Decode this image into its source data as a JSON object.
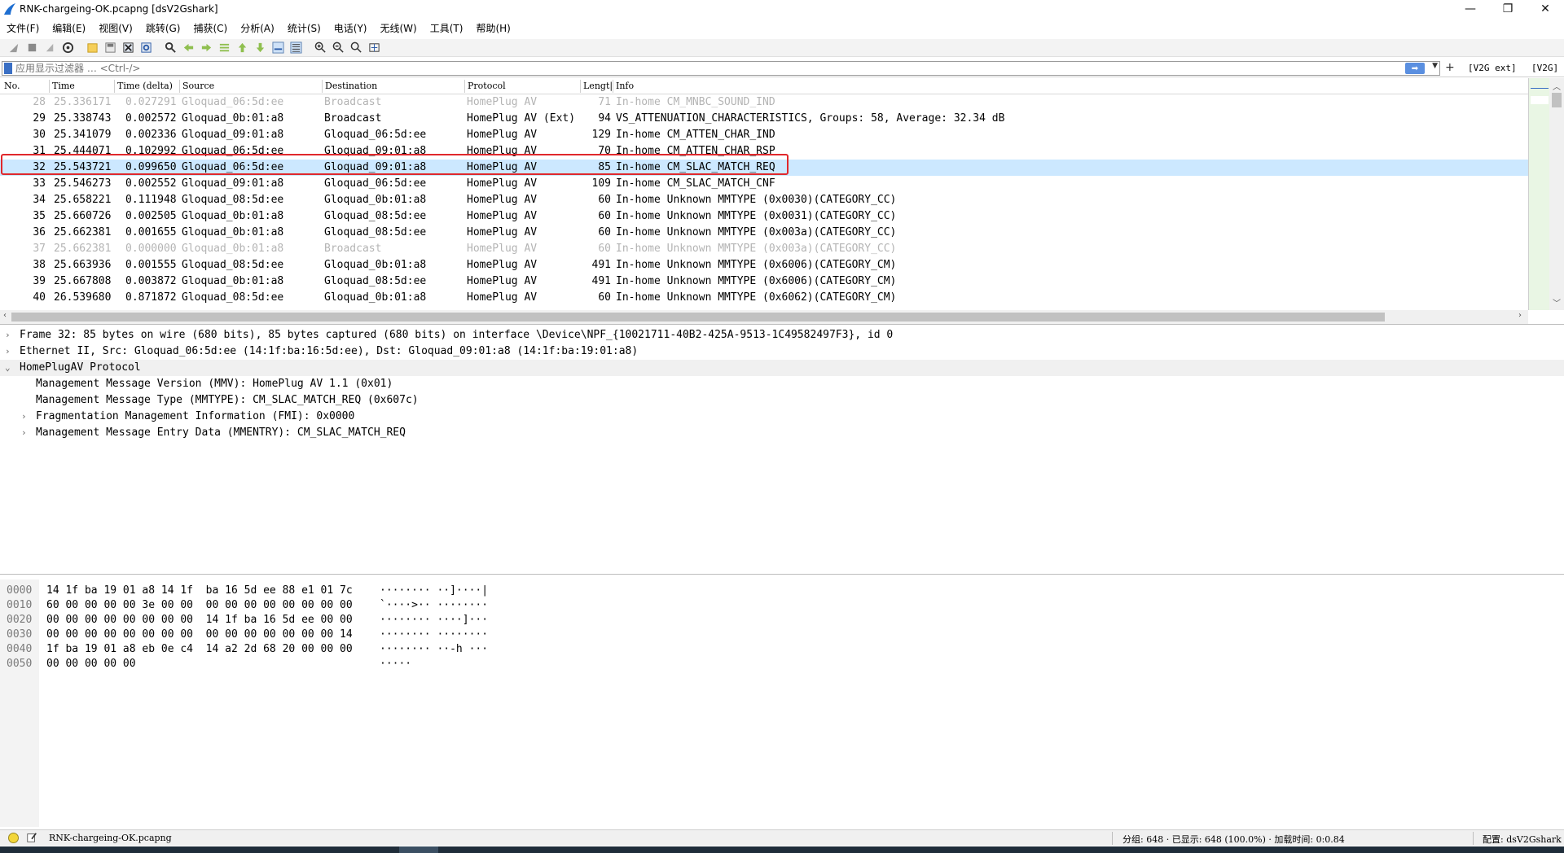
{
  "window": {
    "title": "RNK-chargeing-OK.pcapng [dsV2Gshark]",
    "minimize": "—",
    "restore": "❐",
    "close": "✕"
  },
  "menu": [
    "文件(F)",
    "编辑(E)",
    "视图(V)",
    "跳转(G)",
    "捕获(C)",
    "分析(A)",
    "统计(S)",
    "电话(Y)",
    "无线(W)",
    "工具(T)",
    "帮助(H)"
  ],
  "filter": {
    "placeholder": "应用显示过滤器 … <Ctrl-/>",
    "value": "",
    "apply_icon": "arrow-right-icon",
    "plus_label": "+",
    "button1": "[V2G ext]",
    "button2": "[V2G]"
  },
  "packet_list": {
    "columns": [
      "No.",
      "Time",
      "Time (delta)",
      "Source",
      "Destination",
      "Protocol",
      "Lengt|",
      "Info"
    ],
    "rows": [
      {
        "no": "28",
        "time": "25.336171",
        "delta": "0.027291",
        "src": "Gloquad_06:5d:ee",
        "dst": "Broadcast",
        "proto": "HomePlug AV",
        "len": "71",
        "info": "In-home CM_MNBC_SOUND_IND",
        "dim": true
      },
      {
        "no": "29",
        "time": "25.338743",
        "delta": "0.002572",
        "src": "Gloquad_0b:01:a8",
        "dst": "Broadcast",
        "proto": "HomePlug AV (Ext)",
        "len": "94",
        "info": "VS_ATTENUATION_CHARACTERISTICS, Groups: 58, Average: 32.34 dB"
      },
      {
        "no": "30",
        "time": "25.341079",
        "delta": "0.002336",
        "src": "Gloquad_09:01:a8",
        "dst": "Gloquad_06:5d:ee",
        "proto": "HomePlug AV",
        "len": "129",
        "info": "In-home CM_ATTEN_CHAR_IND"
      },
      {
        "no": "31",
        "time": "25.444071",
        "delta": "0.102992",
        "src": "Gloquad_06:5d:ee",
        "dst": "Gloquad_09:01:a8",
        "proto": "HomePlug AV",
        "len": "70",
        "info": "In-home CM_ATTEN_CHAR_RSP"
      },
      {
        "no": "32",
        "time": "25.543721",
        "delta": "0.099650",
        "src": "Gloquad_06:5d:ee",
        "dst": "Gloquad_09:01:a8",
        "proto": "HomePlug AV",
        "len": "85",
        "info": "In-home CM_SLAC_MATCH_REQ",
        "selected": true
      },
      {
        "no": "33",
        "time": "25.546273",
        "delta": "0.002552",
        "src": "Gloquad_09:01:a8",
        "dst": "Gloquad_06:5d:ee",
        "proto": "HomePlug AV",
        "len": "109",
        "info": "In-home CM_SLAC_MATCH_CNF"
      },
      {
        "no": "34",
        "time": "25.658221",
        "delta": "0.111948",
        "src": "Gloquad_08:5d:ee",
        "dst": "Gloquad_0b:01:a8",
        "proto": "HomePlug AV",
        "len": "60",
        "info": "In-home Unknown MMTYPE (0x0030)(CATEGORY_CC)"
      },
      {
        "no": "35",
        "time": "25.660726",
        "delta": "0.002505",
        "src": "Gloquad_0b:01:a8",
        "dst": "Gloquad_08:5d:ee",
        "proto": "HomePlug AV",
        "len": "60",
        "info": "In-home Unknown MMTYPE (0x0031)(CATEGORY_CC)"
      },
      {
        "no": "36",
        "time": "25.662381",
        "delta": "0.001655",
        "src": "Gloquad_0b:01:a8",
        "dst": "Gloquad_08:5d:ee",
        "proto": "HomePlug AV",
        "len": "60",
        "info": "In-home Unknown MMTYPE (0x003a)(CATEGORY_CC)"
      },
      {
        "no": "37",
        "time": "25.662381",
        "delta": "0.000000",
        "src": "Gloquad_0b:01:a8",
        "dst": "Broadcast",
        "proto": "HomePlug AV",
        "len": "60",
        "info": "In-home Unknown MMTYPE (0x003a)(CATEGORY_CC)",
        "dim": true
      },
      {
        "no": "38",
        "time": "25.663936",
        "delta": "0.001555",
        "src": "Gloquad_08:5d:ee",
        "dst": "Gloquad_0b:01:a8",
        "proto": "HomePlug AV",
        "len": "491",
        "info": "In-home Unknown MMTYPE (0x6006)(CATEGORY_CM)"
      },
      {
        "no": "39",
        "time": "25.667808",
        "delta": "0.003872",
        "src": "Gloquad_0b:01:a8",
        "dst": "Gloquad_08:5d:ee",
        "proto": "HomePlug AV",
        "len": "491",
        "info": "In-home Unknown MMTYPE (0x6006)(CATEGORY_CM)"
      },
      {
        "no": "40",
        "time": "26.539680",
        "delta": "0.871872",
        "src": "Gloquad_08:5d:ee",
        "dst": "Gloquad_0b:01:a8",
        "proto": "HomePlug AV",
        "len": "60",
        "info": "In-home Unknown MMTYPE (0x6062)(CATEGORY_CM)"
      }
    ]
  },
  "details": [
    {
      "twisty": "›",
      "text": "Frame 32: 85 bytes on wire (680 bits), 85 bytes captured (680 bits) on interface \\Device\\NPF_{10021711-40B2-425A-9513-1C49582497F3}, id 0"
    },
    {
      "twisty": "›",
      "text": "Ethernet II, Src: Gloquad_06:5d:ee (14:1f:ba:16:5d:ee), Dst: Gloquad_09:01:a8 (14:1f:ba:19:01:a8)"
    },
    {
      "twisty": "⌄",
      "text": "HomePlugAV Protocol",
      "selected": true
    },
    {
      "twisty": "",
      "text": "Management Message Version (MMV): HomePlug AV 1.1 (0x01)"
    },
    {
      "twisty": "",
      "text": "Management Message Type (MMTYPE): CM_SLAC_MATCH_REQ (0x607c)"
    },
    {
      "twisty": "›",
      "text": "Fragmentation Management Information (FMI): 0x0000"
    },
    {
      "twisty": "›",
      "text": "Management Message Entry Data (MMENTRY): CM_SLAC_MATCH_REQ"
    }
  ],
  "bytes": [
    {
      "off": "0000",
      "hex": "14 1f ba 19 01 a8 14 1f  ba 16 5d ee 88 e1 01 7c",
      "ascii": "········ ··]····|"
    },
    {
      "off": "0010",
      "hex": "60 00 00 00 00 3e 00 00  00 00 00 00 00 00 00 00",
      "ascii": "`····>·· ········"
    },
    {
      "off": "0020",
      "hex": "00 00 00 00 00 00 00 00  14 1f ba 16 5d ee 00 00",
      "ascii": "········ ····]···"
    },
    {
      "off": "0030",
      "hex": "00 00 00 00 00 00 00 00  00 00 00 00 00 00 00 14",
      "ascii": "········ ········"
    },
    {
      "off": "0040",
      "hex": "1f ba 19 01 a8 eb 0e c4  14 a2 2d 68 20 00 00 00",
      "ascii": "········ ··-h ···"
    },
    {
      "off": "0050",
      "hex": "00 00 00 00 00",
      "ascii": "·····"
    }
  ],
  "status": {
    "file": "RNK-chargeing-OK.pcapng",
    "packets": "分组: 648 · 已显示: 648 (100.0%) · 加载时间: 0:0.84",
    "profile": "配置: dsV2Gshark"
  },
  "colors": {
    "selected_row": "#cce8ff",
    "highlight_box": "#e0282c",
    "dim_text": "#b4b4b4"
  }
}
